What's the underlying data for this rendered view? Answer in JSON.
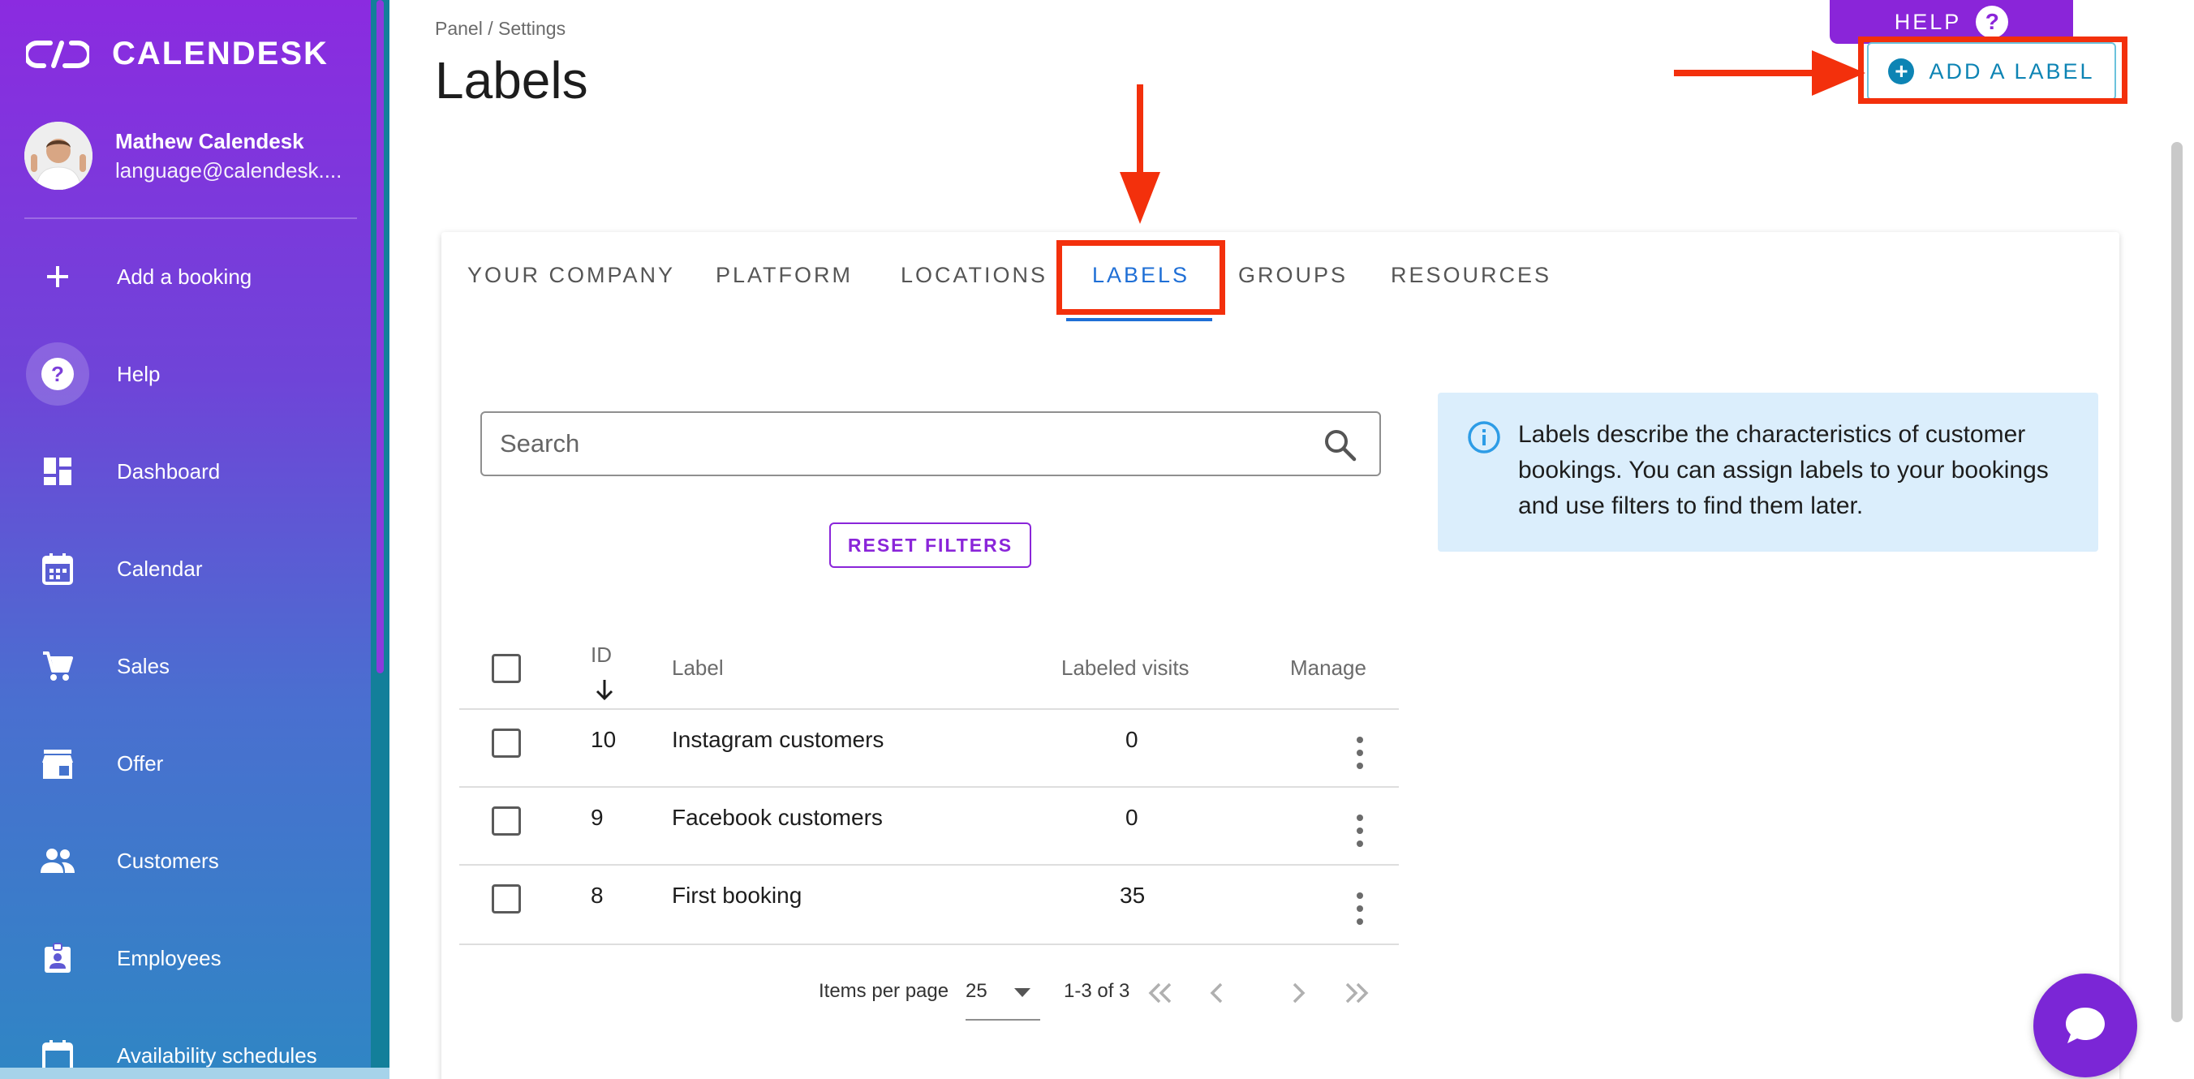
{
  "sidebar": {
    "brand": "CALENDESK",
    "user": {
      "name": "Mathew Calendesk",
      "email": "language@calendesk...."
    },
    "items": [
      {
        "label": "Add a booking",
        "icon": "plus-icon"
      },
      {
        "label": "Help",
        "icon": "help-circle-icon"
      },
      {
        "label": "Dashboard",
        "icon": "dashboard-icon"
      },
      {
        "label": "Calendar",
        "icon": "calendar-icon"
      },
      {
        "label": "Sales",
        "icon": "cart-icon"
      },
      {
        "label": "Offer",
        "icon": "store-icon"
      },
      {
        "label": "Customers",
        "icon": "people-icon"
      },
      {
        "label": "Employees",
        "icon": "badge-icon"
      },
      {
        "label": "Availability schedules",
        "icon": "calendar-clock-icon"
      }
    ]
  },
  "header": {
    "breadcrumb": "Panel / Settings",
    "title": "Labels",
    "help_label": "HELP",
    "help_q": "?",
    "add_label": "ADD A LABEL"
  },
  "tabs": [
    {
      "label": "YOUR COMPANY"
    },
    {
      "label": "PLATFORM"
    },
    {
      "label": "LOCATIONS"
    },
    {
      "label": "LABELS",
      "active": true
    },
    {
      "label": "GROUPS"
    },
    {
      "label": "RESOURCES"
    }
  ],
  "search": {
    "placeholder": "Search"
  },
  "reset_filters": "RESET FILTERS",
  "info": "Labels describe the characteristics of customer bookings. You can assign labels to your bookings and use filters to find them later.",
  "table": {
    "columns": {
      "id": "ID",
      "label": "Label",
      "visits": "Labeled visits",
      "manage": "Manage"
    },
    "rows": [
      {
        "id": "10",
        "label": "Instagram customers",
        "visits": "0"
      },
      {
        "id": "9",
        "label": "Facebook customers",
        "visits": "0"
      },
      {
        "id": "8",
        "label": "First booking",
        "visits": "35"
      }
    ]
  },
  "pagination": {
    "items_per_page_label": "Items per page",
    "per_page": "25",
    "range": "1-3 of 3"
  },
  "colors": {
    "accent_purple": "#8a25d9",
    "tab_blue": "#1f6fd6",
    "annotation_red": "#f3300c",
    "info_bg": "#dbeefc"
  }
}
